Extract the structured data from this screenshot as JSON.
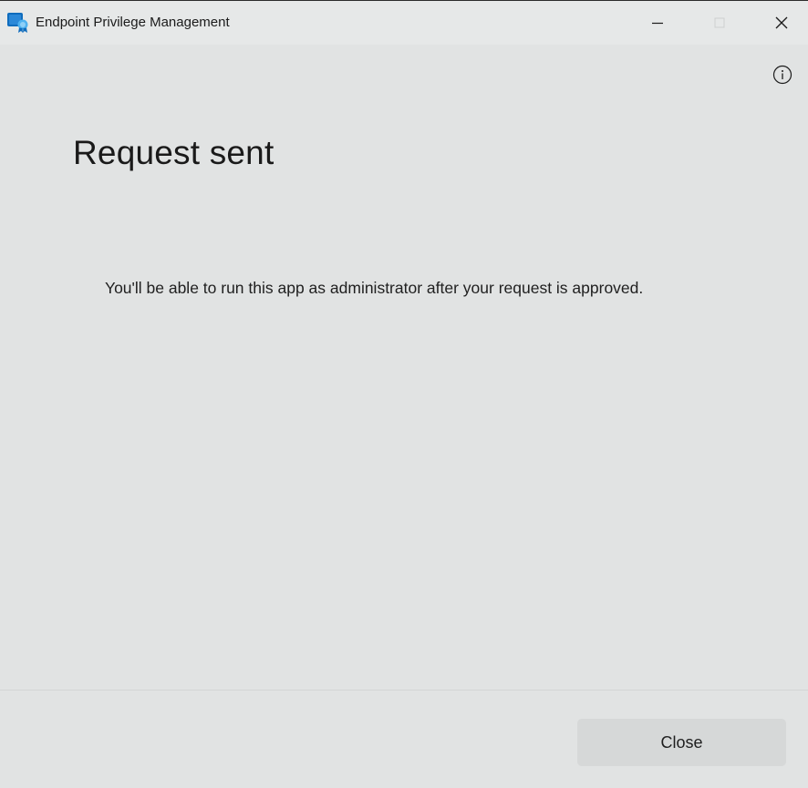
{
  "window": {
    "title": "Endpoint Privilege Management",
    "icon": "endpoint-privilege-management-app-icon",
    "caption_buttons": [
      "minimize-icon",
      "maximize-icon",
      "close-icon"
    ]
  },
  "toolbar": {
    "info_icon": "info-icon"
  },
  "main": {
    "heading": "Request sent",
    "message": "You'll be able to run this app as administrator after your request is approved."
  },
  "footer": {
    "close_label": "Close"
  },
  "colors": {
    "background": "#e1e3e3",
    "button_background": "#d6d8d8",
    "icon_blue": "#0f6cbd",
    "icon_light_blue": "#4fb2f0"
  }
}
